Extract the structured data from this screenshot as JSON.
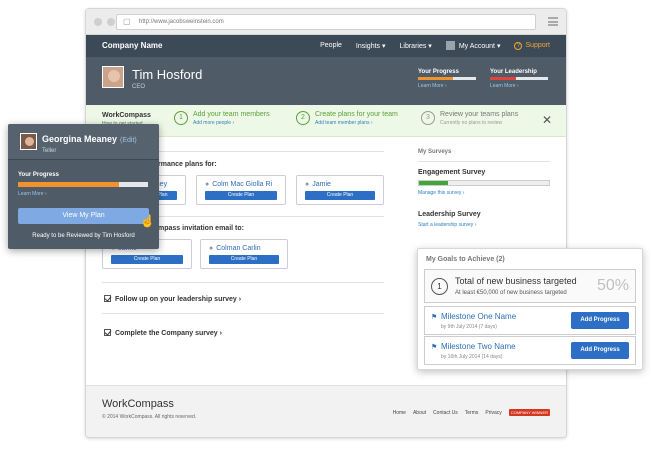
{
  "browser": {
    "url": "http://www.jacobsweinstein.com"
  },
  "nav": {
    "brand": "Company Name",
    "items": [
      "People",
      "Insights ▾",
      "Libraries ▾"
    ],
    "account": "My Account ▾",
    "support": "Support"
  },
  "profile": {
    "name": "Tim Hosford",
    "role": "CEO",
    "your_progress": {
      "label": "Your Progress",
      "link": "Learn More ›",
      "value": 0.6,
      "color": "#f0922e"
    },
    "your_leadership": {
      "label": "Your Leadership",
      "link": "Learn More ›",
      "value": 0.45,
      "color": "#e0443a"
    }
  },
  "onboarding": {
    "brand": "WorkCompass",
    "sub": "How to get started...",
    "steps": [
      {
        "num": "1",
        "title": "Add your team members",
        "sub": "Add more people ›"
      },
      {
        "num": "2",
        "title": "Create plans for your team",
        "sub": "Add team member plans ›"
      },
      {
        "num": "3",
        "title": "Review your teams plans",
        "sub": "Currently no plans to review"
      }
    ],
    "close": "✕"
  },
  "tasks": {
    "plans_title": "rmance plans for:",
    "plans_cards": [
      {
        "name": "eaney",
        "button": "Plan"
      },
      {
        "name": "Colm Mac Giolla Ri",
        "button": "Create Plan"
      },
      {
        "name": "Jamie",
        "button": "Create Plan"
      }
    ],
    "invite_title": "mpass invitation email to:",
    "invite_cards": [
      {
        "name": "Jamie",
        "button": "Create Plan"
      },
      {
        "name": "Colman Carlin",
        "button": "Create Plan"
      }
    ],
    "follow_up": "Follow up on your leadership survey ›",
    "company_survey": "Complete the Company survey ›"
  },
  "surveys": {
    "title": "My Surveys",
    "items": [
      {
        "name": "Engagement Survey",
        "link": "Manage this survey ›",
        "value": 0.22
      },
      {
        "name": "Leadership Survey",
        "link": "Start a leadership survey ›"
      }
    ]
  },
  "footer": {
    "logo": "WorkCompass",
    "copyright": "© 2014 WorkCompass. All rights reserved.",
    "links": [
      "Home",
      "About",
      "Contact Us",
      "Terms",
      "Privacy"
    ],
    "badge": "COMPANY WINNER"
  },
  "employee_card": {
    "name": "Georgina Meaney",
    "edit": "(Edit)",
    "role": "Teller",
    "progress_label": "Your Progress",
    "progress_value": 0.78,
    "learn_more": "Learn More ›",
    "button": "View My Plan",
    "status": "Ready to be Reviewed by Tim Hosford"
  },
  "goals": {
    "title": "My Goals to Achieve (2)",
    "goal": {
      "num": "1",
      "title": "Total of new business targeted",
      "sub": "At least €50,000 of new business targeted",
      "pct": "50%"
    },
    "milestones": [
      {
        "name": "Milestone One Name",
        "date": "by 9th July 2014 (7 days)",
        "button": "Add Progress"
      },
      {
        "name": "Milestone Two Name",
        "date": "by 16th July 2014 (14 days)",
        "button": "Add Progress"
      }
    ]
  }
}
